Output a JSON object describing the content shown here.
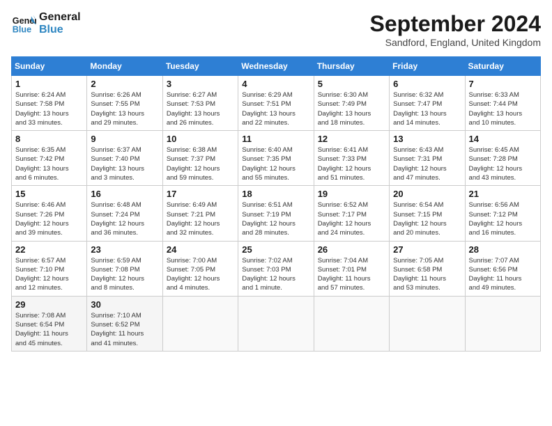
{
  "header": {
    "logo_line1": "General",
    "logo_line2": "Blue",
    "month_title": "September 2024",
    "location": "Sandford, England, United Kingdom"
  },
  "weekdays": [
    "Sunday",
    "Monday",
    "Tuesday",
    "Wednesday",
    "Thursday",
    "Friday",
    "Saturday"
  ],
  "weeks": [
    [
      {
        "day": "1",
        "info": "Sunrise: 6:24 AM\nSunset: 7:58 PM\nDaylight: 13 hours\nand 33 minutes."
      },
      {
        "day": "2",
        "info": "Sunrise: 6:26 AM\nSunset: 7:55 PM\nDaylight: 13 hours\nand 29 minutes."
      },
      {
        "day": "3",
        "info": "Sunrise: 6:27 AM\nSunset: 7:53 PM\nDaylight: 13 hours\nand 26 minutes."
      },
      {
        "day": "4",
        "info": "Sunrise: 6:29 AM\nSunset: 7:51 PM\nDaylight: 13 hours\nand 22 minutes."
      },
      {
        "day": "5",
        "info": "Sunrise: 6:30 AM\nSunset: 7:49 PM\nDaylight: 13 hours\nand 18 minutes."
      },
      {
        "day": "6",
        "info": "Sunrise: 6:32 AM\nSunset: 7:47 PM\nDaylight: 13 hours\nand 14 minutes."
      },
      {
        "day": "7",
        "info": "Sunrise: 6:33 AM\nSunset: 7:44 PM\nDaylight: 13 hours\nand 10 minutes."
      }
    ],
    [
      {
        "day": "8",
        "info": "Sunrise: 6:35 AM\nSunset: 7:42 PM\nDaylight: 13 hours\nand 6 minutes."
      },
      {
        "day": "9",
        "info": "Sunrise: 6:37 AM\nSunset: 7:40 PM\nDaylight: 13 hours\nand 3 minutes."
      },
      {
        "day": "10",
        "info": "Sunrise: 6:38 AM\nSunset: 7:37 PM\nDaylight: 12 hours\nand 59 minutes."
      },
      {
        "day": "11",
        "info": "Sunrise: 6:40 AM\nSunset: 7:35 PM\nDaylight: 12 hours\nand 55 minutes."
      },
      {
        "day": "12",
        "info": "Sunrise: 6:41 AM\nSunset: 7:33 PM\nDaylight: 12 hours\nand 51 minutes."
      },
      {
        "day": "13",
        "info": "Sunrise: 6:43 AM\nSunset: 7:31 PM\nDaylight: 12 hours\nand 47 minutes."
      },
      {
        "day": "14",
        "info": "Sunrise: 6:45 AM\nSunset: 7:28 PM\nDaylight: 12 hours\nand 43 minutes."
      }
    ],
    [
      {
        "day": "15",
        "info": "Sunrise: 6:46 AM\nSunset: 7:26 PM\nDaylight: 12 hours\nand 39 minutes."
      },
      {
        "day": "16",
        "info": "Sunrise: 6:48 AM\nSunset: 7:24 PM\nDaylight: 12 hours\nand 36 minutes."
      },
      {
        "day": "17",
        "info": "Sunrise: 6:49 AM\nSunset: 7:21 PM\nDaylight: 12 hours\nand 32 minutes."
      },
      {
        "day": "18",
        "info": "Sunrise: 6:51 AM\nSunset: 7:19 PM\nDaylight: 12 hours\nand 28 minutes."
      },
      {
        "day": "19",
        "info": "Sunrise: 6:52 AM\nSunset: 7:17 PM\nDaylight: 12 hours\nand 24 minutes."
      },
      {
        "day": "20",
        "info": "Sunrise: 6:54 AM\nSunset: 7:15 PM\nDaylight: 12 hours\nand 20 minutes."
      },
      {
        "day": "21",
        "info": "Sunrise: 6:56 AM\nSunset: 7:12 PM\nDaylight: 12 hours\nand 16 minutes."
      }
    ],
    [
      {
        "day": "22",
        "info": "Sunrise: 6:57 AM\nSunset: 7:10 PM\nDaylight: 12 hours\nand 12 minutes."
      },
      {
        "day": "23",
        "info": "Sunrise: 6:59 AM\nSunset: 7:08 PM\nDaylight: 12 hours\nand 8 minutes."
      },
      {
        "day": "24",
        "info": "Sunrise: 7:00 AM\nSunset: 7:05 PM\nDaylight: 12 hours\nand 4 minutes."
      },
      {
        "day": "25",
        "info": "Sunrise: 7:02 AM\nSunset: 7:03 PM\nDaylight: 12 hours\nand 1 minute."
      },
      {
        "day": "26",
        "info": "Sunrise: 7:04 AM\nSunset: 7:01 PM\nDaylight: 11 hours\nand 57 minutes."
      },
      {
        "day": "27",
        "info": "Sunrise: 7:05 AM\nSunset: 6:58 PM\nDaylight: 11 hours\nand 53 minutes."
      },
      {
        "day": "28",
        "info": "Sunrise: 7:07 AM\nSunset: 6:56 PM\nDaylight: 11 hours\nand 49 minutes."
      }
    ],
    [
      {
        "day": "29",
        "info": "Sunrise: 7:08 AM\nSunset: 6:54 PM\nDaylight: 11 hours\nand 45 minutes."
      },
      {
        "day": "30",
        "info": "Sunrise: 7:10 AM\nSunset: 6:52 PM\nDaylight: 11 hours\nand 41 minutes."
      },
      {
        "day": "",
        "info": ""
      },
      {
        "day": "",
        "info": ""
      },
      {
        "day": "",
        "info": ""
      },
      {
        "day": "",
        "info": ""
      },
      {
        "day": "",
        "info": ""
      }
    ]
  ]
}
